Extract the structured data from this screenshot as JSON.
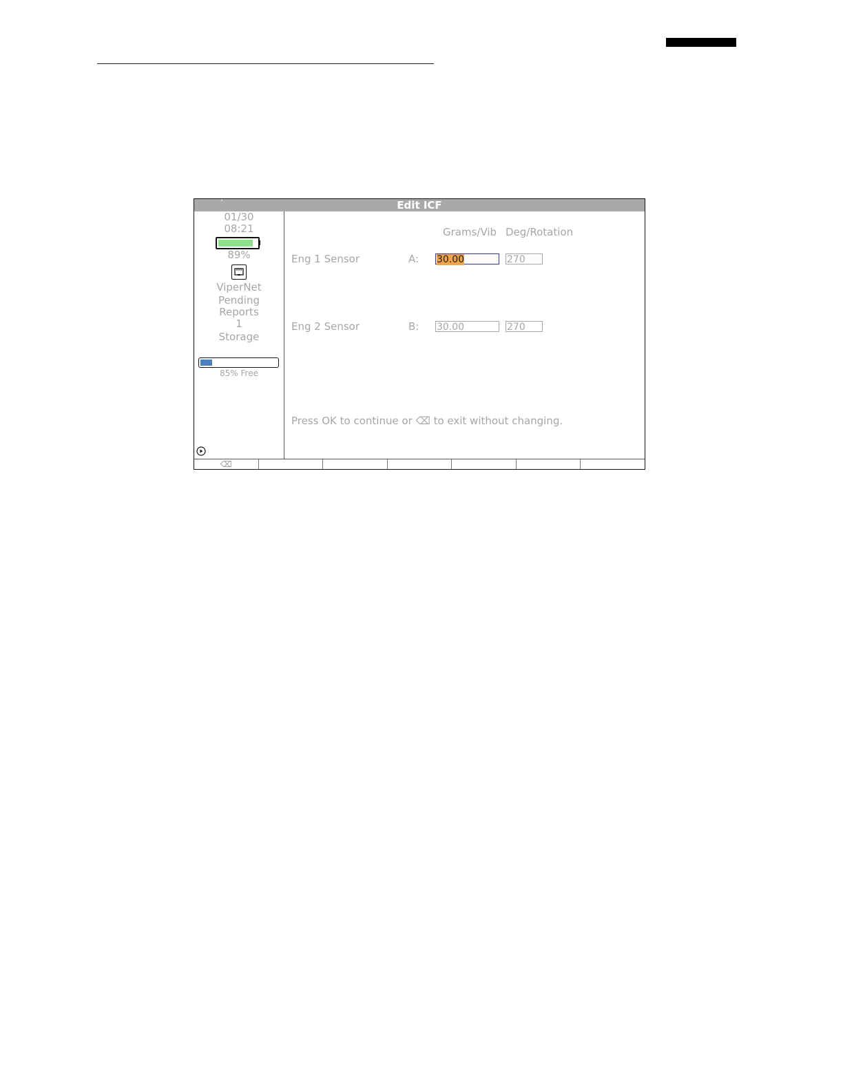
{
  "title": "Edit ICF",
  "sidebar": {
    "date": "01/30",
    "time": "08:21",
    "battery_percent": "89%",
    "battery_level": 0.89,
    "network_label": "ViperNet",
    "pending_label": "Pending",
    "reports_label": "Reports",
    "reports_count": "1",
    "storage_label": "Storage",
    "storage_free": "85% Free",
    "storage_used_fraction": 0.15
  },
  "columns": {
    "grams": "Grams/Vib",
    "deg": "Deg/Rotation"
  },
  "rows": [
    {
      "label": "Eng 1 Sensor",
      "channel": "A:",
      "grams": "30.00",
      "deg": "270"
    },
    {
      "label": "Eng 2 Sensor",
      "channel": "B:",
      "grams": "30.00",
      "deg": "270"
    }
  ],
  "message": "Press OK to continue or ⌫ to exit without changing.",
  "softkeys": [
    "⌫",
    "",
    "",
    "",
    "",
    "",
    ""
  ],
  "colors": {
    "battery": "#8fe08a",
    "storage": "#4b7fbf",
    "highlight": "#f0a34a",
    "titlebar": "#a9a9a9"
  }
}
